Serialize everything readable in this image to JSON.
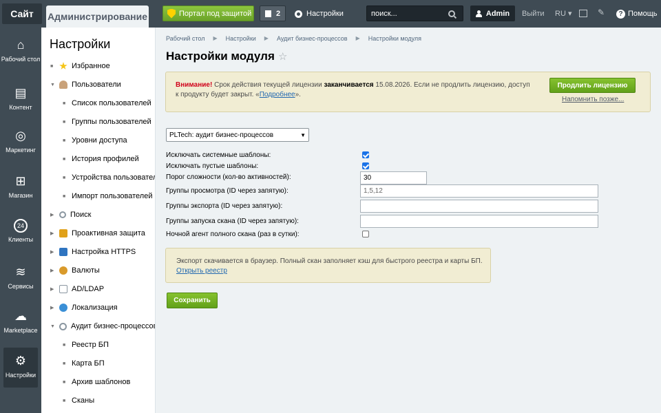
{
  "topbar": {
    "site_tab": "Сайт",
    "admin_tab": "Администрирование",
    "portal_button": "Портал под защитой",
    "notif_count": "2",
    "settings_label": "Настройки",
    "search_placeholder": "поиск...",
    "user_name": "Admin",
    "logout_label": "Выйти",
    "lang_label": "RU",
    "help_label": "Помощь"
  },
  "rail": {
    "items": [
      {
        "label": "Рабочий стол",
        "icon": "home-icon"
      },
      {
        "label": "Контент",
        "icon": "document-icon"
      },
      {
        "label": "Маркетинг",
        "icon": "target-icon"
      },
      {
        "label": "Магазин",
        "icon": "basket-icon"
      },
      {
        "label": "Клиенты",
        "icon": "clients-24-icon",
        "badge": "24"
      },
      {
        "label": "Сервисы",
        "icon": "layers-icon"
      },
      {
        "label": "Marketplace",
        "icon": "cloud-download-icon"
      },
      {
        "label": "Настройки",
        "icon": "gear-icon",
        "active": true
      }
    ]
  },
  "sidebar": {
    "title": "Настройки",
    "items": [
      {
        "label": "Избранное"
      },
      {
        "label": "Пользователи"
      },
      {
        "label": "Список пользователей"
      },
      {
        "label": "Группы пользователей"
      },
      {
        "label": "Уровни доступа"
      },
      {
        "label": "История профилей"
      },
      {
        "label": "Устройства пользователей"
      },
      {
        "label": "Импорт пользователей"
      },
      {
        "label": "Поиск"
      },
      {
        "label": "Проактивная защита"
      },
      {
        "label": "Настройка HTTPS"
      },
      {
        "label": "Валюты"
      },
      {
        "label": "AD/LDAP"
      },
      {
        "label": "Локализация"
      },
      {
        "label": "Аудит бизнес-процессов"
      },
      {
        "label": "Реестр БП"
      },
      {
        "label": "Карта БП"
      },
      {
        "label": "Архив шаблонов"
      },
      {
        "label": "Сканы"
      }
    ]
  },
  "breadcrumb": [
    "Рабочий стол",
    "Настройки",
    "Аудит бизнес-процессов",
    "Настройки модуля"
  ],
  "page_title": "Настройки модуля",
  "notice": {
    "warn": "Внимание!",
    "text1": " Срок действия текущей лицензии ",
    "bold": "заканчивается",
    "text2": " 15.08.2026. Если не продлить лицензию, доступ к продукту будет закрыт. «",
    "link": "Подробнее",
    "text3": "».",
    "renew_button": "Продлить лицензию",
    "remind_link": "Напомнить позже..."
  },
  "module_select": {
    "value": "PLTech: аудит бизнес-процессов"
  },
  "form": {
    "exclude_system_label": "Исключать системные шаблоны:",
    "exclude_system_checked": true,
    "exclude_empty_label": "Исключать пустые шаблоны:",
    "exclude_empty_checked": true,
    "threshold_label": "Порог сложности (кол-во активностей):",
    "threshold_value": "30",
    "view_groups_label": "Группы просмотра (ID через запятую):",
    "view_groups_value": "1,5,12",
    "export_groups_label": "Группы экспорта (ID через запятую):",
    "export_groups_value": "",
    "scan_groups_label": "Группы запуска скана (ID через запятую):",
    "scan_groups_value": "",
    "night_agent_label": "Ночной агент полного скана (раз в сутки):",
    "night_agent_checked": false
  },
  "info": {
    "text": "Экспорт скачивается в браузер. Полный скан заполняет кэш для быстрого реестра и карты БП.",
    "link": "Открыть реестр"
  },
  "save_button": "Сохранить",
  "colors": {
    "accent_green": "#6ba329",
    "topbar": "#3f4b54",
    "notice_bg": "#f1edd3",
    "link": "#2067b0"
  }
}
